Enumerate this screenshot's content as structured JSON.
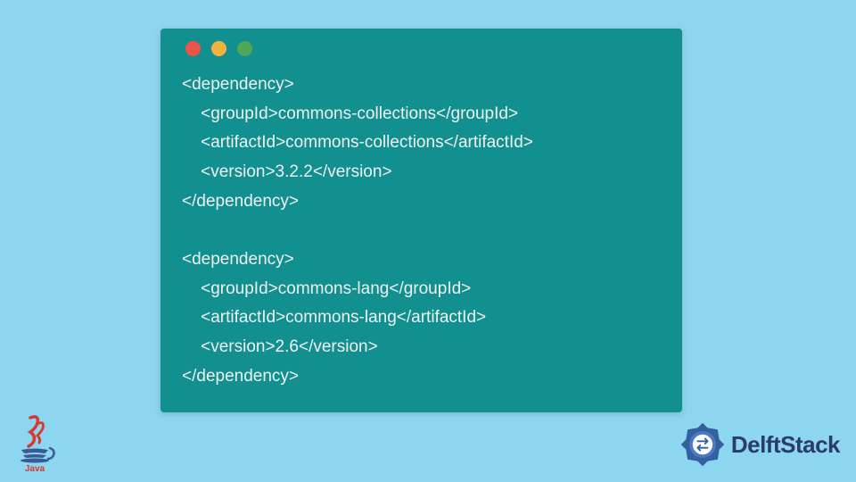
{
  "code": {
    "content": "<dependency>\n    <groupId>commons-collections</groupId>\n    <artifactId>commons-collections</artifactId>\n    <version>3.2.2</version>\n</dependency>\n\n<dependency>\n    <groupId>commons-lang</groupId>\n    <artifactId>commons-lang</artifactId>\n    <version>2.6</version>\n</dependency>"
  },
  "logos": {
    "java": "Java",
    "delft": "DelftStack"
  }
}
